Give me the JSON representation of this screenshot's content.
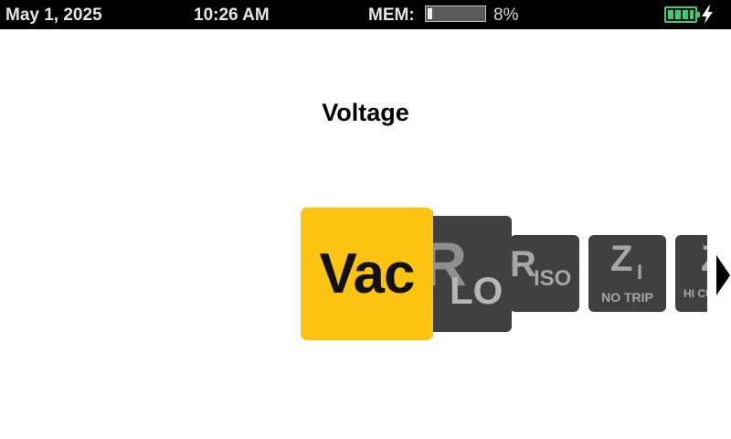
{
  "status": {
    "date": "May 1, 2025",
    "time": "10:26 AM",
    "mem_label": "MEM:",
    "mem_percent_text": "8%",
    "mem_fraction": 0.08,
    "battery_level": 1.0,
    "battery_icon": "battery-full-icon",
    "charging_icon": "lightning-bolt-icon",
    "accent_battery_color": "#2fd27a"
  },
  "title": "Voltage",
  "modes": {
    "vac": {
      "label": "Vac",
      "color": "#fdc312"
    },
    "rlo": {
      "main": "R",
      "sub": "LO"
    },
    "riso": {
      "main": "R",
      "sub": "ISO"
    },
    "zi": {
      "main": "Z",
      "sub": "I",
      "caption": "NO TRIP"
    },
    "zhi": {
      "main": "Z",
      "caption": "HI CU"
    }
  },
  "nav": {
    "next_icon": "chevron-right-icon"
  }
}
